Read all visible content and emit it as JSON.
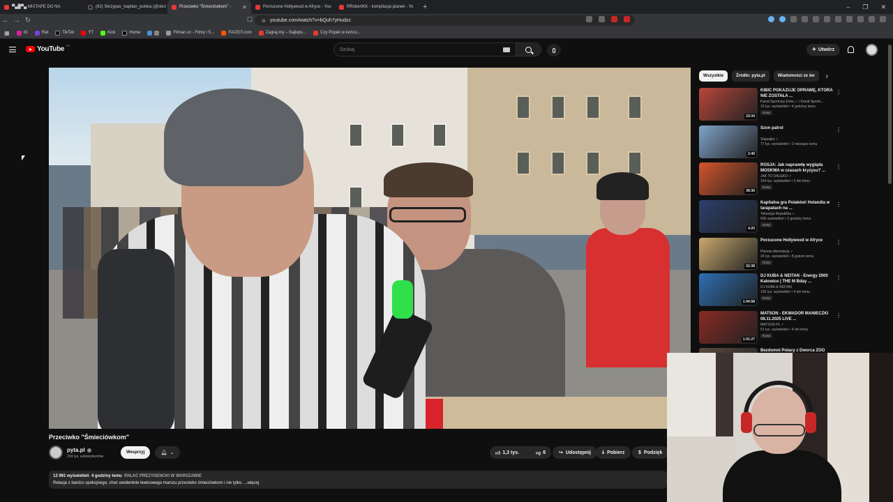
{
  "browser": {
    "tabs": [
      {
        "title": "▀▄█▀▄ MIXTAPE DO NA",
        "active": false
      },
      {
        "title": "(62) Skrzypas_kapitan_polska (@skrz",
        "active": false
      },
      {
        "title": "Przeciwko \"Śmieciówkom\" -",
        "active": true
      },
      {
        "title": "Porzucone Hollywood w Afryce - You",
        "active": false
      },
      {
        "title": "RRobertKK - kompilacja pianek - Yo",
        "active": false
      }
    ],
    "new_tab": "+",
    "url": "youtube.com/watch?v=bQuh7yHudzc",
    "bookmarks": [
      "IG",
      "Rat",
      "TikTok",
      "YT",
      "Kick",
      "Home",
      "Filman.cc - Filmy i S...",
      "FACEIT.com",
      "Zagraj.my – Najleps...",
      "Czy Popek w końcu..."
    ],
    "window_controls": [
      "–",
      "❐",
      "✕"
    ]
  },
  "masthead": {
    "logo_text": "YouTube",
    "logo_region": "PL",
    "search_placeholder": "Szukaj",
    "create_label": "Utwórz"
  },
  "video": {
    "title": "Przeciwko \"Śmieciówkom\"",
    "channel_name": "pyta.pl",
    "subscribers": "234 tys. subskrybentów",
    "support_label": "Wesprzyj",
    "likes": "1,3 tys.",
    "dislikes": "6",
    "share_label": "Udostępnij",
    "download_label": "Pobierz",
    "thanks_label": "Podzięk",
    "views": "12 991 wyświetleń",
    "age": "4 godziny temu",
    "tag": "PAŁAC PREZYDENCKI W WARSZAWIE",
    "description": "Relacja z bardzo spokojnego, choć ewidentnie lewicowego marszu przeciwko śmieciówkom i nie tylko. ...więcej"
  },
  "sidebar": {
    "chips": [
      "Wszystkie",
      "Źródło: pyta.pl",
      "Wiadomości ze św"
    ],
    "recommendations": [
      {
        "title": "KIBIC POKAZUJE OPRAWĘ, KTÓRA NIE ZOSTAŁA ...",
        "channel": "Kanał Sportowy Extra ✓ i Kanał Sporto...",
        "stats": "19 tys. wyświetleń • 4 godziny temu",
        "badge": "Nowy",
        "duration": "23:34",
        "thumb_color": "#b8463a"
      },
      {
        "title": "Szon patrol",
        "channel": "Slajaajka ✓",
        "stats": "77 tys. wyświetleń • 2 miesiące temu",
        "badge": "",
        "duration": "2:40",
        "thumb_color": "#7fa3c9"
      },
      {
        "title": "ROSJA: Jak naprawdę wygląda MOSKWA w czasach kryzysu? ...",
        "channel": "JAK TO DALEKO ✓",
        "stats": "154 tys. wyświetleń • 2 dni temu",
        "badge": "Nowy",
        "duration": "39:36",
        "thumb_color": "#d3542c"
      },
      {
        "title": "Kapitalna gra Polaków! Holandia w tarapatach na ...",
        "channel": "Telewizja Republika ✓",
        "stats": "606 wyświetleń • 2 godziny temu",
        "badge": "Nowy",
        "duration": "4:25",
        "thumb_color": "#2b3f6b"
      },
      {
        "title": "Porzucone Hollywood w Afryce",
        "channel": "Planeta Abstrakcja ✓",
        "stats": "24 tys. wyświetleń • 8 godzin temu",
        "badge": "Nowy",
        "duration": "52:38",
        "thumb_color": "#c9a86e"
      },
      {
        "title": "DJ KUBA & NEITAN - Energy 2000 Katowice | THE M Bday ...",
        "channel": "DJ KUBA & NEITAN",
        "stats": "106 tys. wyświetleń • 4 dni temu",
        "badge": "Nowy",
        "duration": "1:04:58",
        "thumb_color": "#2d6fb3"
      },
      {
        "title": "MATSON - EKWADOR MANIECZKI 08.11.2025 LIVE ...",
        "channel": "MATSON PL ✓",
        "stats": "51 tys. wyświetleń • 4 dni temu",
        "badge": "Nowy",
        "duration": "1:01:27",
        "thumb_color": "#8a2a24"
      },
      {
        "title": "Bezdomni Polacy z Dworca ZOO",
        "channel": "",
        "stats": "",
        "badge": "",
        "duration": "",
        "thumb_color": "#5a4a3e"
      }
    ]
  },
  "colors": {
    "background": "#0f0f0f",
    "brand_red": "#ff0000",
    "chip_active": "#f1f1f1"
  }
}
